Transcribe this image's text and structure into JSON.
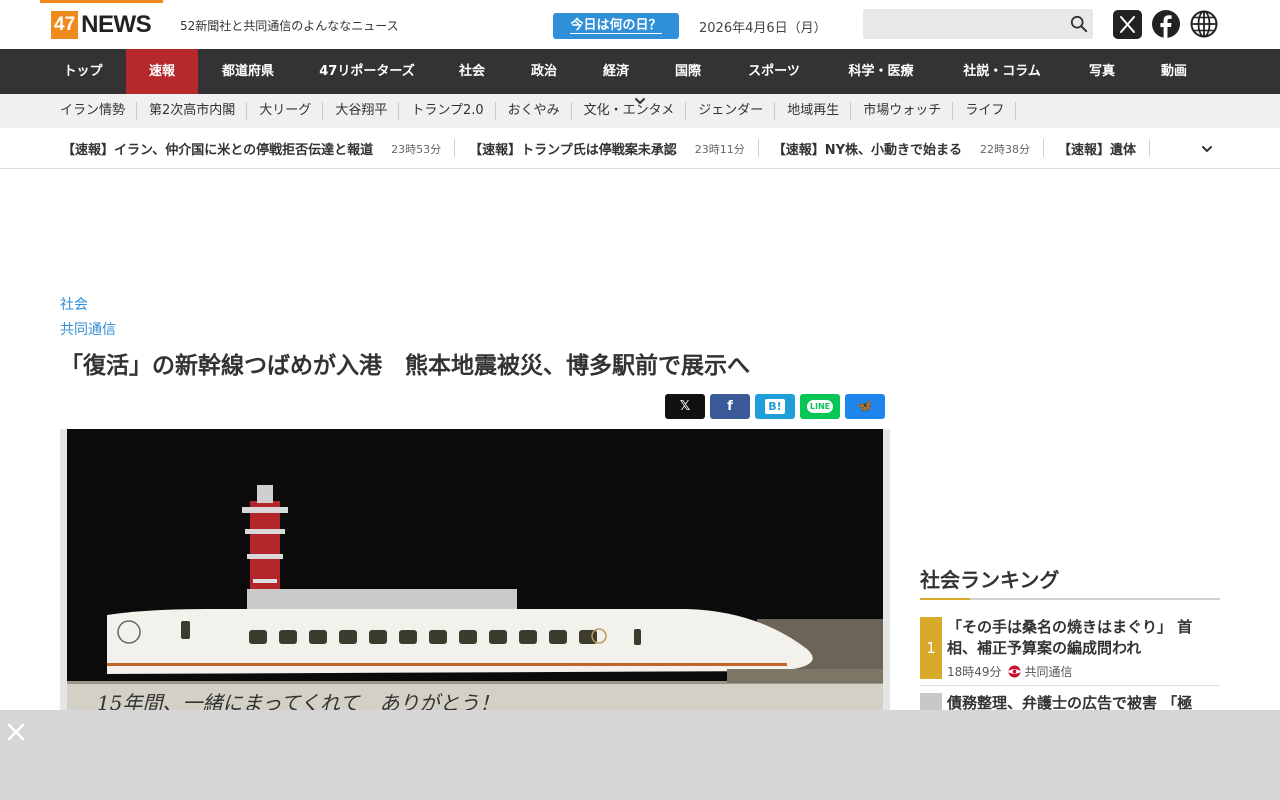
{
  "header": {
    "logo_num": "47",
    "logo_text": "NEWS",
    "tagline": "52新聞社と共同通信のよんななニュース",
    "today_button": "今日は何の日？",
    "date": "2026年4月6日（月）",
    "search_placeholder": ""
  },
  "main_nav": [
    {
      "label": "トップ",
      "w": 86
    },
    {
      "label": "速報",
      "w": 72,
      "active": true
    },
    {
      "label": "都道府県",
      "w": 100
    },
    {
      "label": "47リポーターズ",
      "w": 138
    },
    {
      "label": "社会",
      "w": 72
    },
    {
      "label": "政治",
      "w": 72
    },
    {
      "label": "経済",
      "w": 72
    },
    {
      "label": "国際",
      "w": 72
    },
    {
      "label": "スポーツ",
      "w": 100
    },
    {
      "label": "科学・医療",
      "w": 114
    },
    {
      "label": "社説・コラム",
      "w": 128
    },
    {
      "label": "写真",
      "w": 72
    },
    {
      "label": "動画",
      "w": 72
    }
  ],
  "sub_nav": [
    "イラン情勢",
    "第2次高市内閣",
    "大リーグ",
    "大谷翔平",
    "トランプ2.0",
    "おくやみ",
    "文化・エンタメ",
    "ジェンダー",
    "地域再生",
    "市場ウォッチ",
    "ライフ"
  ],
  "ticker": [
    {
      "text": "【速報】イラン、仲介国に米との停戦拒否伝達と報道",
      "time": "23時53分"
    },
    {
      "text": "【速報】トランプ氏は停戦案未承認",
      "time": "23時11分"
    },
    {
      "text": "【速報】NY株、小動きで始まる",
      "time": "22時38分"
    },
    {
      "text": "【速報】遺体",
      "time": ""
    }
  ],
  "article": {
    "category": "社会",
    "source": "共同通信",
    "title": "「復活」の新幹線つばめが入港　熊本地震被災、博多駅前で展示へ",
    "photo_caption_text": "15年間、一緒にまってくれて　ありがとう！"
  },
  "share_buttons": [
    {
      "name": "x",
      "label": "𝕏",
      "color": "#111111"
    },
    {
      "name": "facebook",
      "label": "f",
      "color": "#3a5a98"
    },
    {
      "name": "hatena",
      "label": "B!",
      "color": "#1f9ed9"
    },
    {
      "name": "line",
      "label": "LINE",
      "color": "#06c755"
    },
    {
      "name": "bluesky",
      "label": "🦋",
      "color": "#1d85ec"
    }
  ],
  "ranking": {
    "heading": "社会ランキング",
    "items": [
      {
        "rank": "1",
        "title": "「その手は桑名の焼きはまぐり」 首相、補正予算案の編成問われ",
        "time": "18時49分",
        "source": "共同通信"
      },
      {
        "rank": "2",
        "title": "債務整理、弁護士の広告で被害 「極",
        "time": "",
        "source": ""
      }
    ]
  },
  "colors": {
    "brand_orange": "#f08a1c",
    "nav_bg": "#333333",
    "nav_active": "#b5282c",
    "link_blue": "#2f8fd8",
    "rank_gold": "#d9a92a"
  }
}
